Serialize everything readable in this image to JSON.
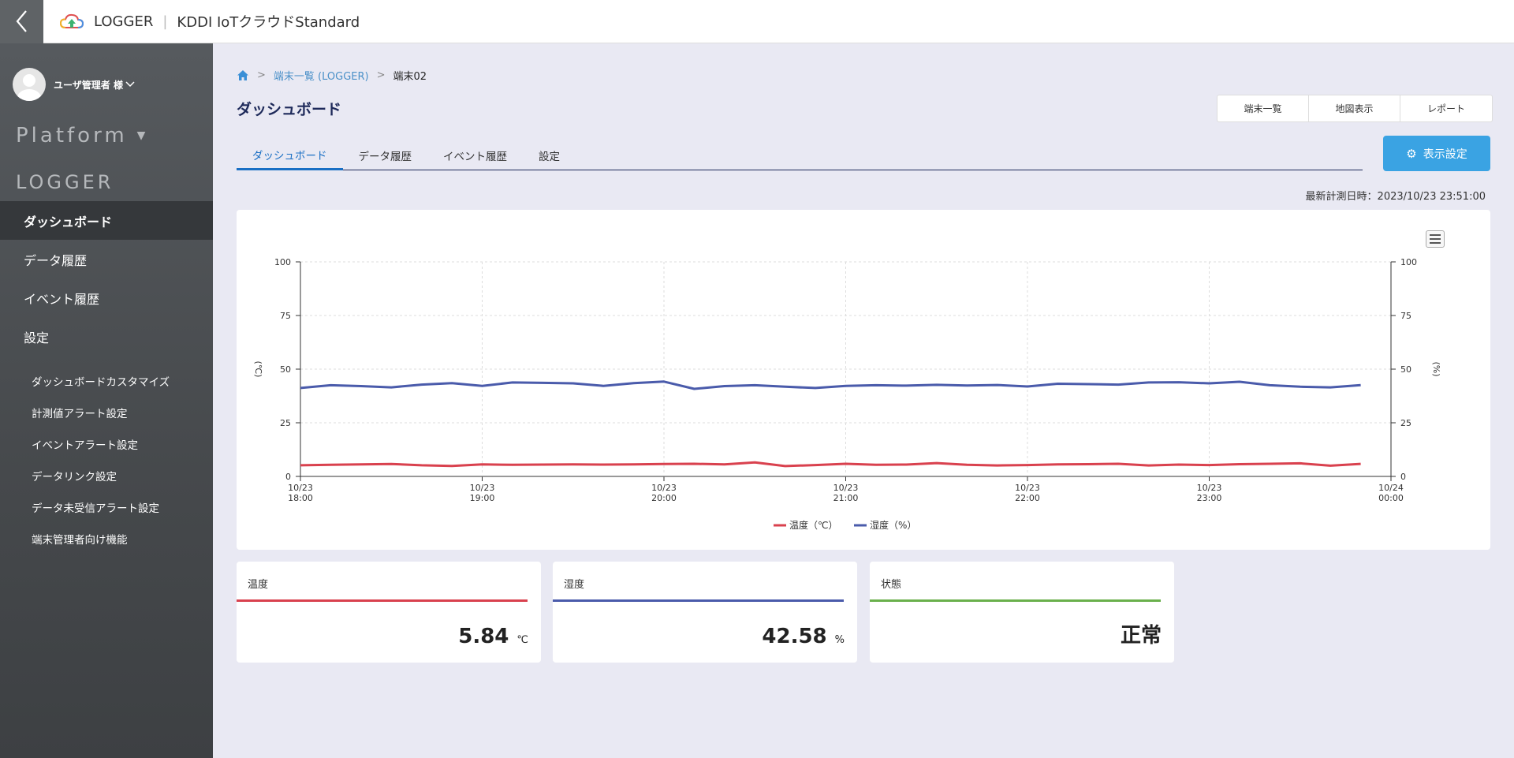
{
  "header": {
    "app_name": "LOGGER",
    "service_name": "KDDI IoTクラウドStandard"
  },
  "sidebar": {
    "user_name": "ユーザ管理者 様",
    "platform_label": "Platform",
    "section_title": "LOGGER",
    "nav": [
      {
        "label": "ダッシュボード"
      },
      {
        "label": "データ履歴"
      },
      {
        "label": "イベント履歴"
      },
      {
        "label": "設定"
      }
    ],
    "sub_nav": [
      {
        "label": "ダッシュボードカスタマイズ"
      },
      {
        "label": "計測値アラート設定"
      },
      {
        "label": "イベントアラート設定"
      },
      {
        "label": "データリンク設定"
      },
      {
        "label": "データ未受信アラート設定"
      },
      {
        "label": "端末管理者向け機能"
      }
    ]
  },
  "breadcrumb": {
    "list": "端末一覧 (LOGGER)",
    "current": "端末02"
  },
  "page": {
    "title": "ダッシュボード",
    "last_measured": "最新計測日時：2023/10/23 23:51:00"
  },
  "buttons": {
    "device_list": "端末一覧",
    "map_view": "地図表示",
    "report": "レポート",
    "display_settings": "表示設定"
  },
  "tabs": [
    {
      "label": "ダッシュボード"
    },
    {
      "label": "データ履歴"
    },
    {
      "label": "イベント履歴"
    },
    {
      "label": "設定"
    }
  ],
  "chart_data": {
    "type": "line",
    "x": [
      "18:00",
      "18:10",
      "18:20",
      "18:30",
      "18:40",
      "18:50",
      "19:00",
      "19:10",
      "19:20",
      "19:30",
      "19:40",
      "19:50",
      "20:00",
      "20:10",
      "20:20",
      "20:30",
      "20:40",
      "20:50",
      "21:00",
      "21:10",
      "21:20",
      "21:30",
      "21:40",
      "21:50",
      "22:00",
      "22:10",
      "22:20",
      "22:30",
      "22:40",
      "22:50",
      "23:00",
      "23:10",
      "23:20",
      "23:30",
      "23:40",
      "23:50"
    ],
    "x_tick_labels": [
      [
        "10/23",
        "18:00"
      ],
      [
        "10/23",
        "19:00"
      ],
      [
        "10/23",
        "20:00"
      ],
      [
        "10/23",
        "21:00"
      ],
      [
        "10/23",
        "22:00"
      ],
      [
        "10/23",
        "23:00"
      ],
      [
        "10/24",
        "00:00"
      ]
    ],
    "y_ticks": [
      0,
      25,
      50,
      75,
      100
    ],
    "ylim": [
      0,
      100
    ],
    "ylabel_left": "(℃)",
    "ylabel_right": "(%)",
    "grid": true,
    "legend_position": "bottom-center",
    "series": [
      {
        "name": "温度（℃）",
        "color": "#d9414e",
        "values": [
          5.2,
          5.4,
          5.6,
          5.8,
          5.2,
          4.9,
          5.6,
          5.4,
          5.5,
          5.6,
          5.5,
          5.6,
          5.8,
          5.9,
          5.6,
          6.5,
          4.8,
          5.3,
          5.9,
          5.4,
          5.5,
          6.2,
          5.4,
          5.1,
          5.3,
          5.6,
          5.7,
          5.9,
          5.1,
          5.5,
          5.3,
          5.7,
          5.9,
          6.1,
          5.0,
          5.84
        ]
      },
      {
        "name": "湿度（%）",
        "color": "#4a5bab",
        "values": [
          41.2,
          42.5,
          42.1,
          41.5,
          42.8,
          43.5,
          42.2,
          43.8,
          43.6,
          43.4,
          42.2,
          43.5,
          44.2,
          40.8,
          42.1,
          42.5,
          41.8,
          41.2,
          42.2,
          42.5,
          42.3,
          42.7,
          42.4,
          42.6,
          41.9,
          43.2,
          43.0,
          42.8,
          43.8,
          43.9,
          43.4,
          44.1,
          42.5,
          41.8,
          41.5,
          42.58
        ]
      }
    ]
  },
  "metrics": [
    {
      "title": "温度",
      "value": "5.84",
      "unit": "℃",
      "color": "#d9414e"
    },
    {
      "title": "湿度",
      "value": "42.58",
      "unit": "%",
      "color": "#4a5bab"
    },
    {
      "title": "状態",
      "value": "正常",
      "unit": "",
      "color": "#6ab04c"
    }
  ]
}
